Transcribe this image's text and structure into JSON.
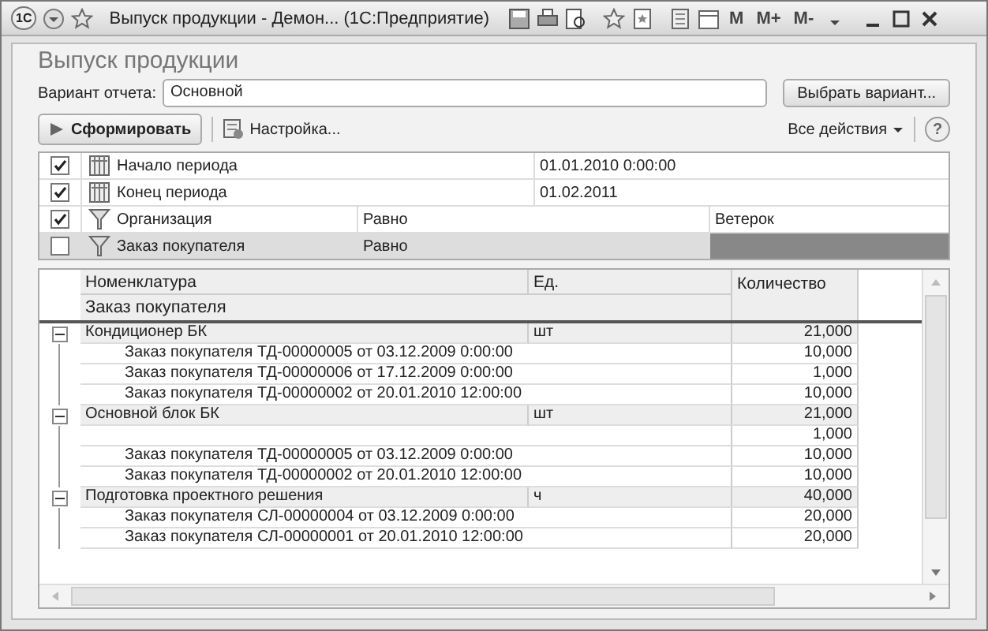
{
  "window": {
    "title": "Выпуск продукции - Демон...  (1С:Предприятие)",
    "logo": "1С",
    "memory_buttons": [
      "M",
      "M+",
      "M-"
    ]
  },
  "form_title": "Выпуск продукции",
  "variant": {
    "label": "Вариант отчета:",
    "value": "Основной",
    "button": "Выбрать вариант..."
  },
  "toolbar": {
    "generate": "Сформировать",
    "settings": "Настройка...",
    "all_actions": "Все действия",
    "help": "?"
  },
  "settings": [
    {
      "checked": true,
      "kind": "period",
      "name": "Начало периода",
      "value": "01.01.2010 0:00:00",
      "selected": false
    },
    {
      "checked": true,
      "kind": "period",
      "name": "Конец периода",
      "value": "01.02.2011",
      "selected": false
    },
    {
      "checked": true,
      "kind": "filter",
      "name": "Организация",
      "condition": "Равно",
      "value": "Ветерок",
      "selected": false
    },
    {
      "checked": false,
      "kind": "filter",
      "name": "Заказ покупателя",
      "condition": "Равно",
      "selected": true
    }
  ],
  "report": {
    "columns": [
      "Номенклатура",
      "Ед.",
      "Количество"
    ],
    "subheader": "Заказ покупателя",
    "rows": [
      {
        "name": "Кондиционер БК",
        "unit": "шт",
        "quantity": "21,000",
        "expanded": true,
        "children": [
          {
            "name": "Заказ покупателя ТД-00000005 от 03.12.2009 0:00:00",
            "quantity": "10,000"
          },
          {
            "name": "Заказ покупателя ТД-00000006 от 17.12.2009 0:00:00",
            "quantity": "1,000"
          },
          {
            "name": "Заказ покупателя ТД-00000002 от 20.01.2010 12:00:00",
            "quantity": "10,000"
          }
        ]
      },
      {
        "name": "Основной блок БК",
        "unit": "шт",
        "quantity": "21,000",
        "expanded": true,
        "children": [
          {
            "quantity": "1,000"
          },
          {
            "name": "Заказ покупателя ТД-00000005 от 03.12.2009 0:00:00",
            "quantity": "10,000"
          },
          {
            "name": "Заказ покупателя ТД-00000002 от 20.01.2010 12:00:00",
            "quantity": "10,000"
          }
        ]
      },
      {
        "name": "Подготовка проектного решения",
        "unit": "ч",
        "quantity": "40,000",
        "expanded": true,
        "children": [
          {
            "name": "Заказ покупателя СЛ-00000004 от 03.12.2009 0:00:00",
            "quantity": "20,000"
          },
          {
            "name": "Заказ покупателя СЛ-00000001 от 20.01.2010 12:00:00",
            "quantity": "20,000"
          }
        ]
      }
    ]
  }
}
